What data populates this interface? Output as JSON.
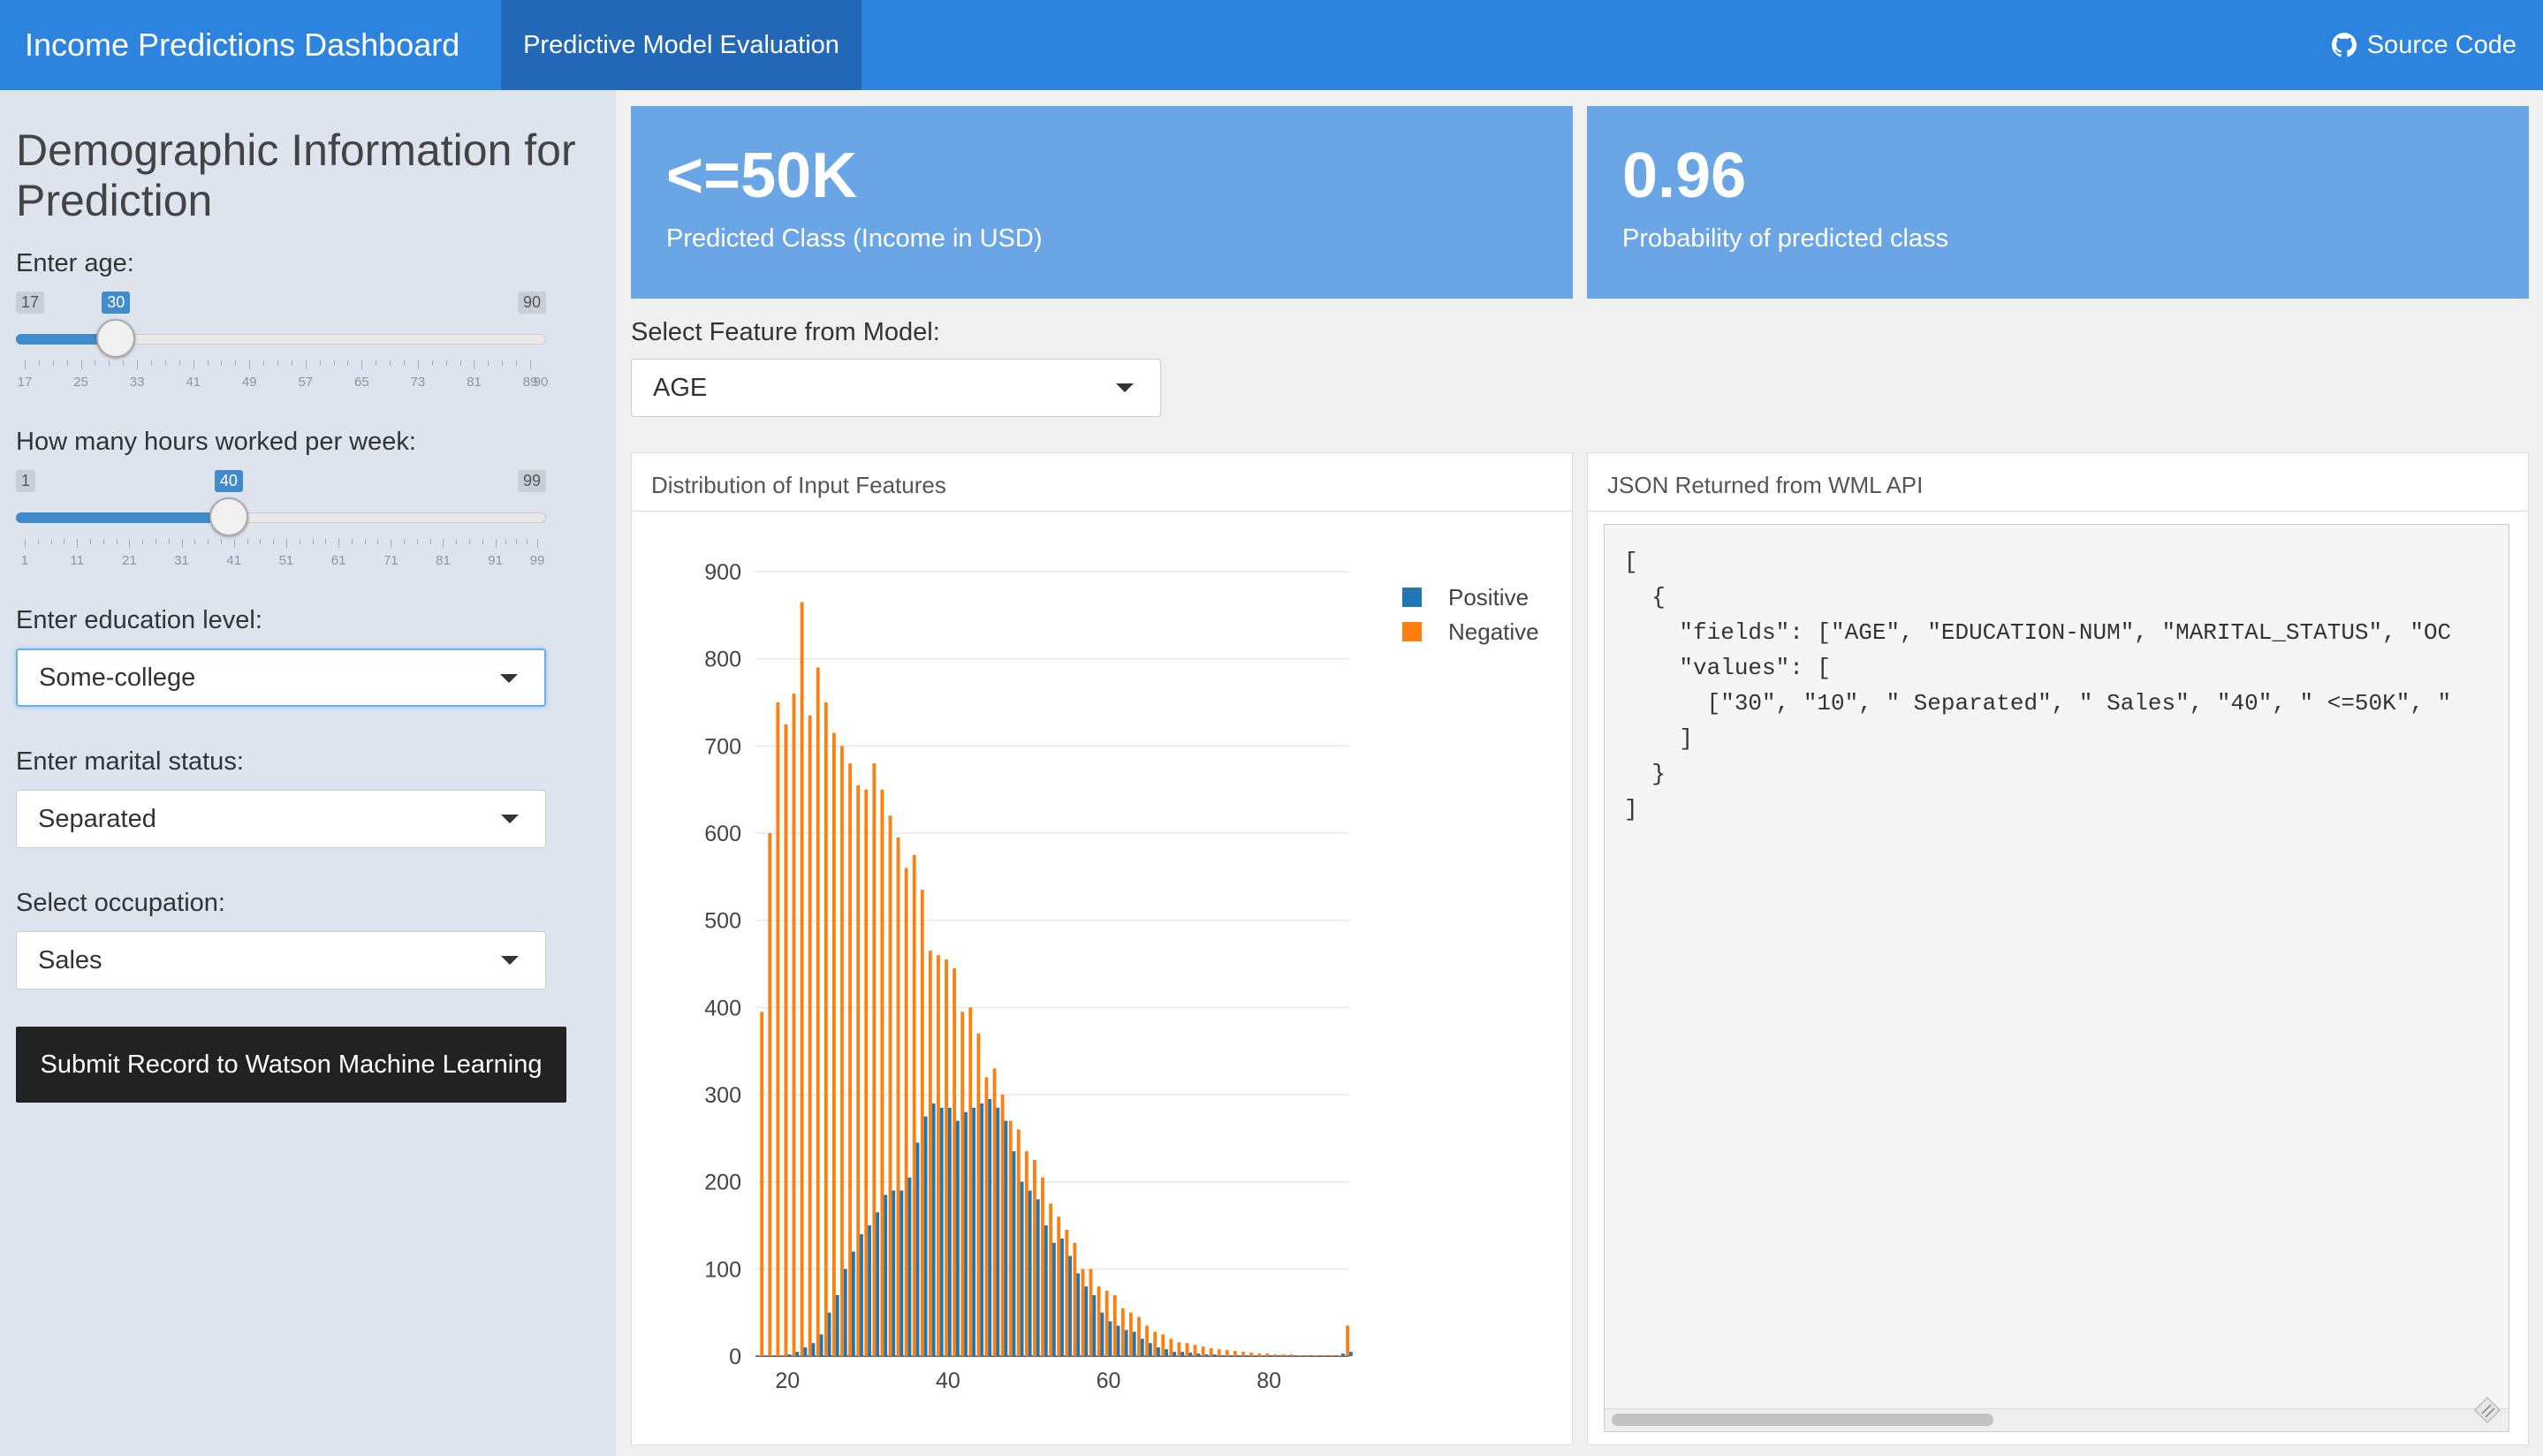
{
  "navbar": {
    "brand": "Income Predictions Dashboard",
    "tab": "Predictive Model Evaluation",
    "source_link": "Source Code",
    "icon": "github-icon"
  },
  "sidebar": {
    "title": "Demographic Information for Prediction",
    "age": {
      "label": "Enter age:",
      "min": 17,
      "max": 90,
      "value": 30,
      "min_label": "17",
      "max_label": "90",
      "value_label": "30",
      "tick_labels": [
        "17",
        "25",
        "33",
        "41",
        "49",
        "57",
        "65",
        "73",
        "81",
        "89"
      ],
      "tick_values": [
        17,
        25,
        33,
        41,
        49,
        57,
        65,
        73,
        81,
        89
      ],
      "extra_tick_label": "90"
    },
    "hours": {
      "label": "How many hours worked per week:",
      "min": 1,
      "max": 99,
      "value": 40,
      "min_label": "1",
      "max_label": "99",
      "value_label": "40",
      "tick_labels": [
        "1",
        "11",
        "21",
        "31",
        "41",
        "51",
        "61",
        "71",
        "81",
        "91",
        "99"
      ],
      "tick_values": [
        1,
        11,
        21,
        31,
        41,
        51,
        61,
        71,
        81,
        91,
        99
      ]
    },
    "education": {
      "label": "Enter education level:",
      "value": "Some-college"
    },
    "marital": {
      "label": "Enter marital status:",
      "value": "Separated"
    },
    "occupation": {
      "label": "Select occupation:",
      "value": "Sales"
    },
    "submit": "Submit Record to Watson Machine Learning"
  },
  "valueboxes": [
    {
      "value": "<=50K",
      "caption": "Predicted Class (Income in USD)"
    },
    {
      "value": "0.96",
      "caption": "Probability of predicted class"
    }
  ],
  "feature_select": {
    "label": "Select Feature from Model:",
    "value": "AGE"
  },
  "chart_panel": {
    "title": "Distribution of Input Features"
  },
  "json_panel": {
    "title": "JSON Returned from WML API",
    "lines": [
      "[",
      "  {",
      "    \"fields\": [\"AGE\", \"EDUCATION-NUM\", \"MARITAL_STATUS\", \"OC",
      "    \"values\": [",
      "      [\"30\", \"10\", \" Separated\", \" Sales\", \"40\", \" <=50K\", \"",
      "    ]",
      "  }",
      "]"
    ]
  },
  "colors": {
    "positive": "#1f77b4",
    "negative": "#ff7f0e",
    "navbar": "#2d84de",
    "accent": "#428bca"
  },
  "chart_data": {
    "type": "bar",
    "title": "",
    "xlabel": "",
    "ylabel": "",
    "x": [
      17,
      18,
      19,
      20,
      21,
      22,
      23,
      24,
      25,
      26,
      27,
      28,
      29,
      30,
      31,
      32,
      33,
      34,
      35,
      36,
      37,
      38,
      39,
      40,
      41,
      42,
      43,
      44,
      45,
      46,
      47,
      48,
      49,
      50,
      51,
      52,
      53,
      54,
      55,
      56,
      57,
      58,
      59,
      60,
      61,
      62,
      63,
      64,
      65,
      66,
      67,
      68,
      69,
      70,
      71,
      72,
      73,
      74,
      75,
      76,
      77,
      78,
      79,
      80,
      81,
      82,
      83,
      84,
      85,
      86,
      87,
      88,
      89,
      90
    ],
    "xlim": [
      16,
      90
    ],
    "ylim": [
      0,
      900
    ],
    "xticks": [
      20,
      40,
      60,
      80
    ],
    "yticks": [
      0,
      100,
      200,
      300,
      400,
      500,
      600,
      700,
      800,
      900
    ],
    "legend_position": "top-right",
    "series": [
      {
        "name": "Positive",
        "color": "#1f77b4",
        "values": [
          0,
          0,
          0,
          2,
          5,
          10,
          15,
          25,
          50,
          70,
          100,
          120,
          140,
          150,
          165,
          185,
          190,
          190,
          205,
          245,
          275,
          290,
          285,
          285,
          270,
          280,
          285,
          290,
          295,
          285,
          270,
          235,
          200,
          190,
          180,
          150,
          130,
          135,
          115,
          95,
          80,
          70,
          50,
          40,
          35,
          30,
          28,
          20,
          15,
          10,
          8,
          5,
          5,
          4,
          3,
          2,
          2,
          1,
          1,
          1,
          1,
          0,
          0,
          1,
          0,
          0,
          0,
          0,
          0,
          0,
          0,
          0,
          3,
          5
        ]
      },
      {
        "name": "Negative",
        "color": "#ff7f0e",
        "values": [
          395,
          600,
          750,
          725,
          760,
          865,
          735,
          790,
          750,
          715,
          700,
          680,
          655,
          650,
          680,
          650,
          620,
          595,
          560,
          575,
          535,
          465,
          460,
          455,
          445,
          395,
          400,
          370,
          320,
          330,
          300,
          270,
          260,
          235,
          225,
          205,
          175,
          160,
          145,
          130,
          100,
          100,
          80,
          75,
          70,
          55,
          50,
          45,
          35,
          28,
          25,
          20,
          16,
          15,
          13,
          11,
          9,
          8,
          7,
          6,
          5,
          4,
          3,
          3,
          2,
          2,
          2,
          1,
          1,
          1,
          1,
          1,
          1,
          35
        ]
      }
    ]
  }
}
